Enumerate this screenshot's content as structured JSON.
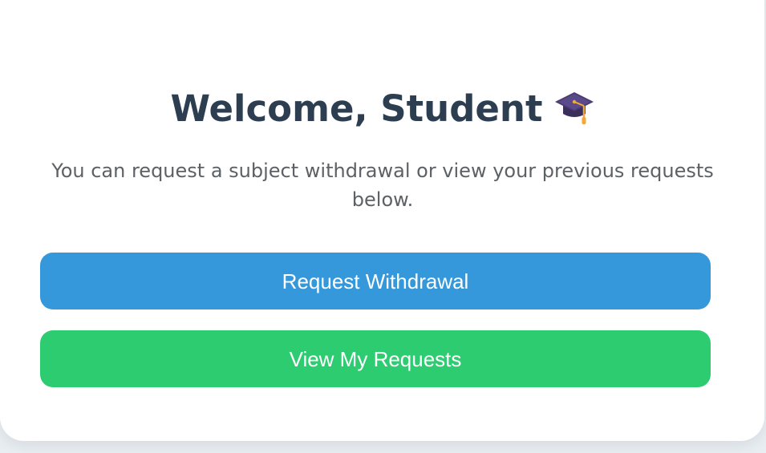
{
  "card": {
    "title": "Welcome, Student",
    "title_icon": "graduation-cap-icon",
    "subtitle": "You can request a subject withdrawal or view your previous requests below."
  },
  "buttons": {
    "request_label": "Request Withdrawal",
    "view_label": "View My Requests"
  },
  "colors": {
    "title": "#2c3e50",
    "subtitle": "#5c6166",
    "request_button": "#3498db",
    "view_button": "#2ecc71"
  }
}
